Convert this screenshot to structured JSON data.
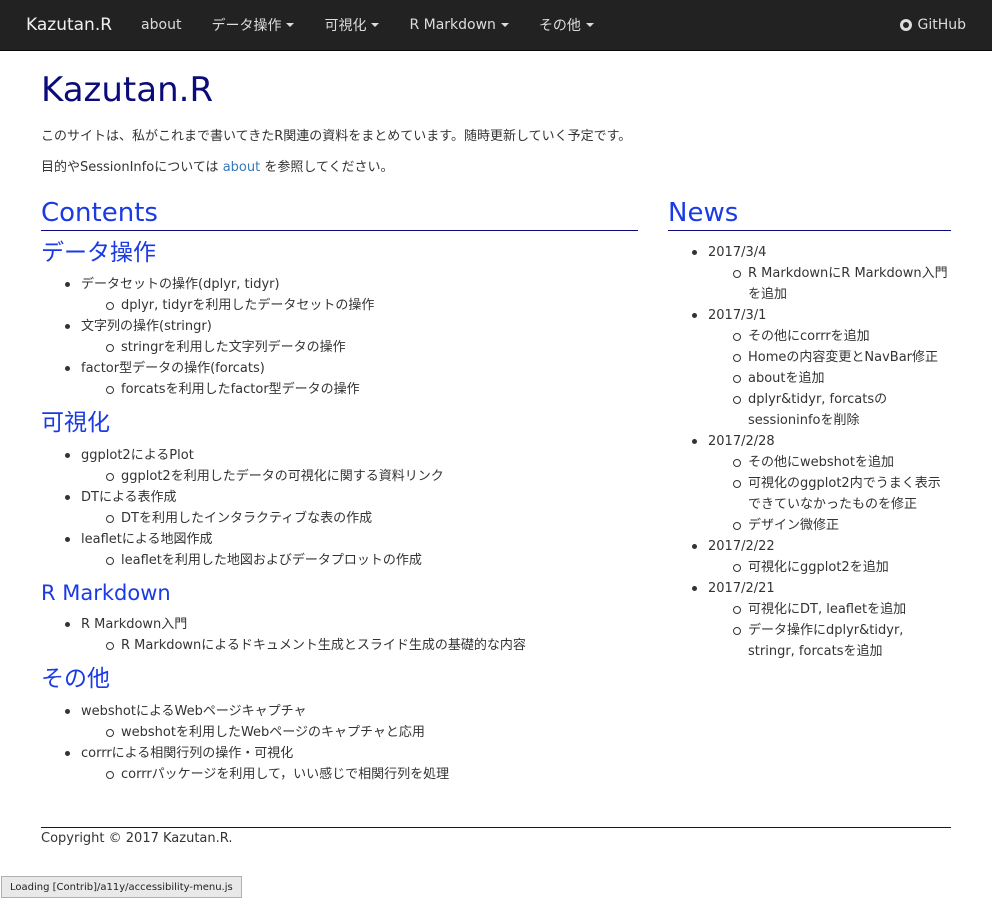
{
  "navbar": {
    "brand": "Kazutan.R",
    "items": [
      {
        "label": "about",
        "dropdown": false
      },
      {
        "label": "データ操作",
        "dropdown": true
      },
      {
        "label": "可視化",
        "dropdown": true
      },
      {
        "label": "R Markdown",
        "dropdown": true
      },
      {
        "label": "その他",
        "dropdown": true
      }
    ],
    "github_label": "GitHub",
    "github_icon": "github-icon"
  },
  "page": {
    "title": "Kazutan.R",
    "intro1": "このサイトは、私がこれまで書いてきたR関連の資料をまとめています。随時更新していく予定です。",
    "intro2_before": "目的やSessionInfoについては ",
    "intro2_link": "about",
    "intro2_after": " を参照してください。"
  },
  "contents": {
    "heading": "Contents",
    "sections": [
      {
        "title": "データ操作",
        "items": [
          {
            "label": "データセットの操作(dplyr, tidyr)",
            "sub": "dplyr, tidyrを利用したデータセットの操作"
          },
          {
            "label": "文字列の操作(stringr)",
            "sub": "stringrを利用した文字列データの操作"
          },
          {
            "label": "factor型データの操作(forcats)",
            "sub": "forcatsを利用したfactor型データの操作"
          }
        ]
      },
      {
        "title": "可視化",
        "items": [
          {
            "label": "ggplot2によるPlot",
            "sub": "ggplot2を利用したデータの可視化に関する資料リンク"
          },
          {
            "label": "DTによる表作成",
            "sub": "DTを利用したインタラクティブな表の作成"
          },
          {
            "label": "leafletによる地図作成",
            "sub": "leafletを利用した地図およびデータプロットの作成"
          }
        ]
      },
      {
        "title": "R Markdown",
        "items": [
          {
            "label": "R Markdown入門",
            "sub": "R Markdownによるドキュメント生成とスライド生成の基礎的な内容"
          }
        ]
      },
      {
        "title": "その他",
        "items": [
          {
            "label": "webshotによるWebページキャプチャ",
            "sub": "webshotを利用したWebページのキャプチャと応用"
          },
          {
            "label": "corrrによる相関行列の操作・可視化",
            "sub": "corrrパッケージを利用して，いい感じで相関行列を処理"
          }
        ]
      }
    ]
  },
  "news": {
    "heading": "News",
    "entries": [
      {
        "date": "2017/3/4",
        "items": [
          "R MarkdownにR Markdown入門を追加"
        ]
      },
      {
        "date": "2017/3/1",
        "items": [
          "その他にcorrrを追加",
          "Homeの内容変更とNavBar修正",
          "aboutを追加",
          "dplyr&tidyr, forcatsのsessioninfoを削除"
        ]
      },
      {
        "date": "2017/2/28",
        "items": [
          "その他にwebshotを追加",
          "可視化のggplot2内でうまく表示できていなかったものを修正",
          "デザイン微修正"
        ]
      },
      {
        "date": "2017/2/22",
        "items": [
          "可視化にggplot2を追加"
        ]
      },
      {
        "date": "2017/2/21",
        "items": [
          "可視化にDT, leafletを追加",
          "データ操作にdplyr&tidyr, stringr, forcatsを追加"
        ]
      }
    ]
  },
  "footer": {
    "copyright": "Copyright © 2017 Kazutan.R."
  },
  "status": {
    "text": "Loading [Contrib]/a11y/accessibility-menu.js"
  }
}
